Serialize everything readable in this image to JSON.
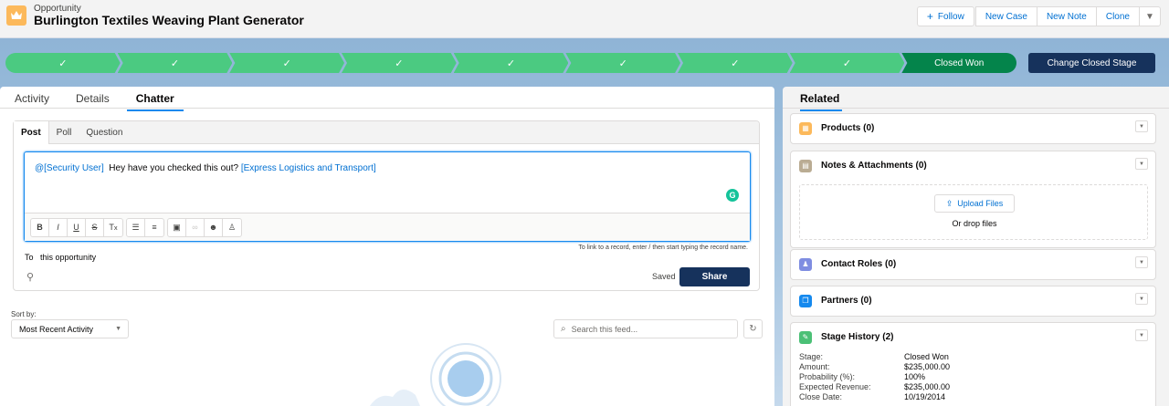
{
  "header": {
    "object_type": "Opportunity",
    "record_name": "Burlington Textiles Weaving Plant Generator",
    "buttons": {
      "follow": "Follow",
      "new_case": "New Case",
      "new_note": "New Note",
      "clone": "Clone"
    }
  },
  "path": {
    "completed_steps": 8,
    "current_stage": "Closed Won",
    "change_stage_label": "Change Closed Stage"
  },
  "main": {
    "tabs": [
      "Activity",
      "Details",
      "Chatter"
    ],
    "active_tab": "Chatter",
    "publisher": {
      "tabs": [
        "Post",
        "Poll",
        "Question"
      ],
      "mention_user": "@[Security User]",
      "message_text": "Hey have you checked this out?",
      "mention_record": "[Express Logistics and Transport]",
      "hint": "To link to a record, enter / then start typing the record name.",
      "to_label": "To",
      "to_value": "this opportunity",
      "saved_label": "Saved",
      "share_label": "Share"
    },
    "sort_by_label": "Sort by:",
    "sort_value": "Most Recent Activity",
    "search_placeholder": "Search this feed..."
  },
  "related": {
    "tab_label": "Related",
    "cards": {
      "products": "Products (0)",
      "notes": "Notes & Attachments (0)",
      "upload_label": "Upload Files",
      "drop_text": "Or drop files",
      "contact_roles": "Contact Roles (0)",
      "partners": "Partners (0)",
      "stage_history": "Stage History (2)"
    },
    "stage_history": [
      {
        "label": "Stage:",
        "value": "Closed Won"
      },
      {
        "label": "Amount:",
        "value": "$235,000.00"
      },
      {
        "label": "Probability (%):",
        "value": "100%"
      },
      {
        "label": "Expected Revenue:",
        "value": "$235,000.00"
      },
      {
        "label": "Close Date:",
        "value": "10/19/2014"
      }
    ]
  },
  "colors": {
    "path_complete": "#4bca81",
    "path_current": "#04844b",
    "brand_dark": "#16325c",
    "link_blue": "#0070d2"
  }
}
